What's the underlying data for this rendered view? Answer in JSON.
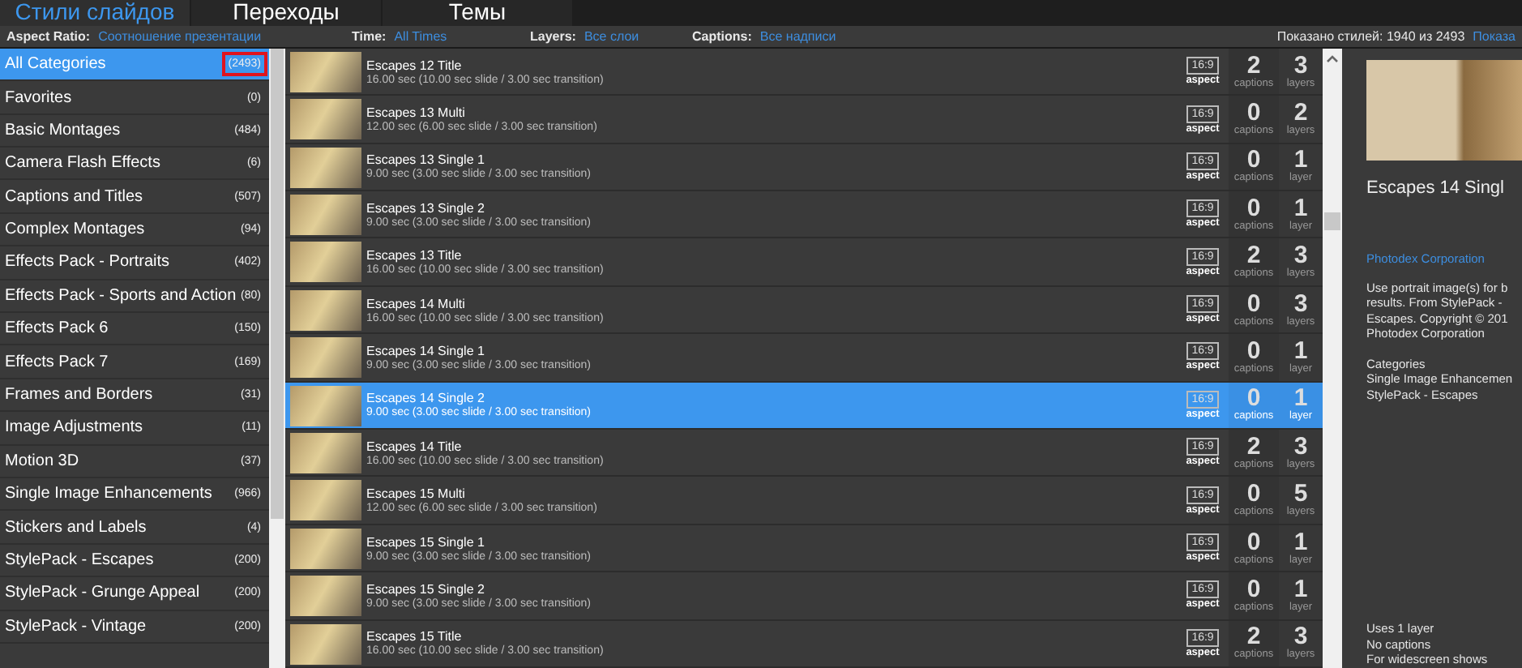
{
  "tabs": [
    {
      "label": "Стили слайдов",
      "selected": true
    },
    {
      "label": "Переходы",
      "selected": false
    },
    {
      "label": "Темы",
      "selected": false
    }
  ],
  "filters": [
    {
      "label": "Aspect Ratio:",
      "value": "Соотношение презентации"
    },
    {
      "label": "Time:",
      "value": "All Times"
    },
    {
      "label": "Layers:",
      "value": "Все слои"
    },
    {
      "label": "Captions:",
      "value": "Все надписи"
    }
  ],
  "shown_count": "Показано стилей: 1940 из 2493",
  "show_link": "Показа",
  "categories": [
    {
      "name": "All Categories",
      "count": "(2493)",
      "selected": true,
      "highlighted": true
    },
    {
      "name": "Favorites",
      "count": "(0)",
      "selected": false,
      "highlighted": false
    },
    {
      "name": "Basic Montages",
      "count": "(484)",
      "selected": false,
      "highlighted": false
    },
    {
      "name": "Camera Flash Effects",
      "count": "(6)",
      "selected": false,
      "highlighted": false
    },
    {
      "name": "Captions and Titles",
      "count": "(507)",
      "selected": false,
      "highlighted": false
    },
    {
      "name": "Complex Montages",
      "count": "(94)",
      "selected": false,
      "highlighted": false
    },
    {
      "name": "Effects Pack - Portraits",
      "count": "(402)",
      "selected": false,
      "highlighted": false
    },
    {
      "name": "Effects Pack - Sports and Action",
      "count": "(80)",
      "selected": false,
      "highlighted": false
    },
    {
      "name": "Effects Pack 6",
      "count": "(150)",
      "selected": false,
      "highlighted": false
    },
    {
      "name": "Effects Pack 7",
      "count": "(169)",
      "selected": false,
      "highlighted": false
    },
    {
      "name": "Frames and Borders",
      "count": "(31)",
      "selected": false,
      "highlighted": false
    },
    {
      "name": "Image Adjustments",
      "count": "(11)",
      "selected": false,
      "highlighted": false
    },
    {
      "name": "Motion 3D",
      "count": "(37)",
      "selected": false,
      "highlighted": false
    },
    {
      "name": "Single Image Enhancements",
      "count": "(966)",
      "selected": false,
      "highlighted": false
    },
    {
      "name": "Stickers and Labels",
      "count": "(4)",
      "selected": false,
      "highlighted": false
    },
    {
      "name": "StylePack - Escapes",
      "count": "(200)",
      "selected": false,
      "highlighted": false
    },
    {
      "name": "StylePack - Grunge Appeal",
      "count": "(200)",
      "selected": false,
      "highlighted": false
    },
    {
      "name": "StylePack - Vintage",
      "count": "(200)",
      "selected": false,
      "highlighted": false
    }
  ],
  "styles": [
    {
      "title": "Escapes 12 Title",
      "duration": "16.00 sec (10.00 sec slide / 3.00 sec transition)",
      "aspect": "16:9",
      "aspect_label": "aspect",
      "captions": "2",
      "captions_label": "captions",
      "layers": "3",
      "layers_label": "layers",
      "selected": false
    },
    {
      "title": "Escapes 13 Multi",
      "duration": "12.00 sec (6.00 sec slide / 3.00 sec transition)",
      "aspect": "16:9",
      "aspect_label": "aspect",
      "captions": "0",
      "captions_label": "captions",
      "layers": "2",
      "layers_label": "layers",
      "selected": false
    },
    {
      "title": "Escapes 13 Single 1",
      "duration": "9.00 sec (3.00 sec slide / 3.00 sec transition)",
      "aspect": "16:9",
      "aspect_label": "aspect",
      "captions": "0",
      "captions_label": "captions",
      "layers": "1",
      "layers_label": "layer",
      "selected": false
    },
    {
      "title": "Escapes 13 Single 2",
      "duration": "9.00 sec (3.00 sec slide / 3.00 sec transition)",
      "aspect": "16:9",
      "aspect_label": "aspect",
      "captions": "0",
      "captions_label": "captions",
      "layers": "1",
      "layers_label": "layer",
      "selected": false
    },
    {
      "title": "Escapes 13 Title",
      "duration": "16.00 sec (10.00 sec slide / 3.00 sec transition)",
      "aspect": "16:9",
      "aspect_label": "aspect",
      "captions": "2",
      "captions_label": "captions",
      "layers": "3",
      "layers_label": "layers",
      "selected": false
    },
    {
      "title": "Escapes 14 Multi",
      "duration": "16.00 sec (10.00 sec slide / 3.00 sec transition)",
      "aspect": "16:9",
      "aspect_label": "aspect",
      "captions": "0",
      "captions_label": "captions",
      "layers": "3",
      "layers_label": "layers",
      "selected": false
    },
    {
      "title": "Escapes 14 Single 1",
      "duration": "9.00 sec (3.00 sec slide / 3.00 sec transition)",
      "aspect": "16:9",
      "aspect_label": "aspect",
      "captions": "0",
      "captions_label": "captions",
      "layers": "1",
      "layers_label": "layer",
      "selected": false
    },
    {
      "title": "Escapes 14 Single 2",
      "duration": "9.00 sec (3.00 sec slide / 3.00 sec transition)",
      "aspect": "16:9",
      "aspect_label": "aspect",
      "captions": "0",
      "captions_label": "captions",
      "layers": "1",
      "layers_label": "layer",
      "selected": true
    },
    {
      "title": "Escapes 14 Title",
      "duration": "16.00 sec (10.00 sec slide / 3.00 sec transition)",
      "aspect": "16:9",
      "aspect_label": "aspect",
      "captions": "2",
      "captions_label": "captions",
      "layers": "3",
      "layers_label": "layers",
      "selected": false
    },
    {
      "title": "Escapes 15 Multi",
      "duration": "12.00 sec (6.00 sec slide / 3.00 sec transition)",
      "aspect": "16:9",
      "aspect_label": "aspect",
      "captions": "0",
      "captions_label": "captions",
      "layers": "5",
      "layers_label": "layers",
      "selected": false
    },
    {
      "title": "Escapes 15 Single 1",
      "duration": "9.00 sec (3.00 sec slide / 3.00 sec transition)",
      "aspect": "16:9",
      "aspect_label": "aspect",
      "captions": "0",
      "captions_label": "captions",
      "layers": "1",
      "layers_label": "layer",
      "selected": false
    },
    {
      "title": "Escapes 15 Single 2",
      "duration": "9.00 sec (3.00 sec slide / 3.00 sec transition)",
      "aspect": "16:9",
      "aspect_label": "aspect",
      "captions": "0",
      "captions_label": "captions",
      "layers": "1",
      "layers_label": "layer",
      "selected": false
    },
    {
      "title": "Escapes 15 Title",
      "duration": "16.00 sec (10.00 sec slide / 3.00 sec transition)",
      "aspect": "16:9",
      "aspect_label": "aspect",
      "captions": "2",
      "captions_label": "captions",
      "layers": "3",
      "layers_label": "layers",
      "selected": false
    }
  ],
  "detail": {
    "title": "Escapes 14 Singl",
    "author": "Photodex Corporation",
    "description": "Use portrait image(s) for b\nresults. From StylePack -\nEscapes. Copyright © 201\nPhotodex Corporation",
    "categories_heading": "Categories",
    "categories": "Single Image Enhancemen\nStylePack - Escapes",
    "footer": "Uses 1 layer\nNo captions\nFor widescreen shows"
  }
}
